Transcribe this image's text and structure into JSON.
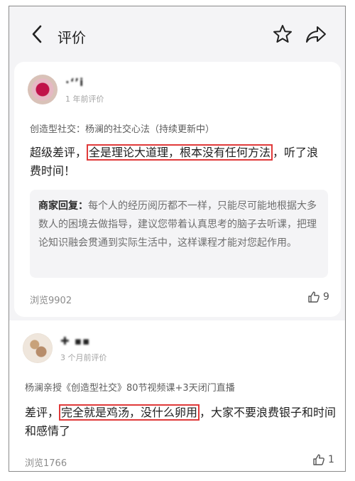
{
  "header": {
    "title": "评价",
    "back_icon": "chevron-left-icon",
    "favorite_icon": "star-icon",
    "share_icon": "share-arrow-icon"
  },
  "reviews": [
    {
      "username": "·‘’ⅰ",
      "time": "1 年前评价",
      "course": "创造型社交：杨澜的社交心法（持续更新中）",
      "text_before": "超级差评，",
      "text_highlight": "全是理论大道理，根本没有任何方法",
      "text_after": "，听了浪费时间！",
      "reply_label": "商家回复：",
      "reply_text": "每个人的经历阅历都不一样，只能尽可能地根据大多数人的困境去做指导，建议您带着认真思考的脑子去听课，把理论知识融会贯通到实际生活中，这样课程才能对您起作用。",
      "views": "浏览9902",
      "likes": "9"
    },
    {
      "username": "✚ ▪▪",
      "time": "3 个月前评价",
      "course": "杨澜亲授《创造型社交》80节视频课+3天闭门直播",
      "text_before": "差评，",
      "text_highlight": "完全就是鸡汤，没什么卵用",
      "text_after": "，大家不要浪费银子和时间和感情了",
      "views": "浏览1766",
      "likes": "1"
    }
  ],
  "colors": {
    "highlight_border": "#e03a3a",
    "background": "#f4f4f6"
  }
}
